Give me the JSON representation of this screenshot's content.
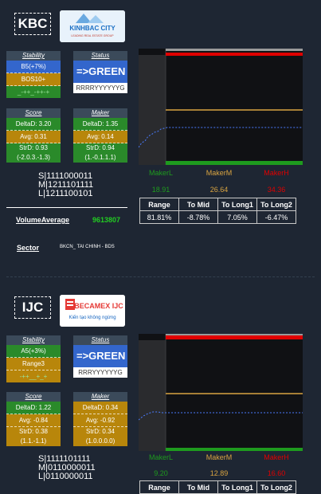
{
  "card1": {
    "ticker": "KBC",
    "logo_text": "KINHBAC CITY",
    "logo_sub": "LEADING REAL ESTATE GROUP",
    "stability": {
      "title": "Stability",
      "rows": [
        "B5(+7%)",
        "BOS10+",
        "_-++_-++-+"
      ]
    },
    "status": {
      "title": "Status",
      "main": "=>GREEN",
      "sub": "RRRRYYYYYYG"
    },
    "score": {
      "title": "Score",
      "rows": [
        "DeltaD: 3.20",
        "Avg: 0.31",
        "StrD: 0.93",
        "(-2.0.3.-1.3)"
      ]
    },
    "maker": {
      "title": "Maker",
      "rows": [
        "DeltaD: 1.35",
        "Avg: 0.14",
        "StrD: 0.94",
        "(1.-0.1.1.1)"
      ]
    },
    "seq": [
      "S|1111000011",
      "M|1211101111",
      "L|1211100101"
    ],
    "volume_label": "VolumeAverage",
    "volume_value": "9613807",
    "sector_label": "Sector",
    "sector_value": "BKCN_ TAI CHINH - BDS",
    "makers": {
      "labels": [
        "MakerL",
        "MakerM",
        "MakerH"
      ],
      "values": [
        "18.91",
        "26.64",
        "34.36"
      ]
    },
    "table": {
      "headers": [
        "Range",
        "To Mid",
        "To Long1",
        "To Long2"
      ],
      "values": [
        "81.81%",
        "-8.78%",
        "7.05%",
        "-6.47%"
      ]
    }
  },
  "card2": {
    "ticker": "IJC",
    "logo_text": "BECAMEX IJC",
    "logo_sub": "Kiến tạo không ngừng",
    "stability": {
      "title": "Stability",
      "rows": [
        "A5(+3%)",
        "Range3",
        "-++__+_+"
      ]
    },
    "status": {
      "title": "Status",
      "main": "=>GREEN",
      "sub": "RRRYYYYYYG"
    },
    "score": {
      "title": "Score",
      "rows": [
        "DeltaD: 1.22",
        "Avg: -0.84",
        "StrD: 0.38",
        "(1.1.-1.1)"
      ]
    },
    "maker": {
      "title": "Maker",
      "rows": [
        "DeltaD: 0.34",
        "Avg: -0.92",
        "StrD: 0.34",
        "(1.0.0.0.0)"
      ]
    },
    "seq": [
      "S|1111101111",
      "M|0110000011",
      "L|0110000011"
    ],
    "makers": {
      "labels": [
        "MakerL",
        "MakerM",
        "MakerH"
      ],
      "values": [
        "9.20",
        "12.89",
        "16.60"
      ]
    },
    "table": {
      "headers": [
        "Range",
        "To Mid",
        "To Long1",
        "To Long2"
      ]
    }
  },
  "colors": {
    "bg": "#1e2633",
    "green": "#2a8a2a",
    "gold": "#b8860b",
    "blue": "#3366cc",
    "red": "#e00000"
  }
}
